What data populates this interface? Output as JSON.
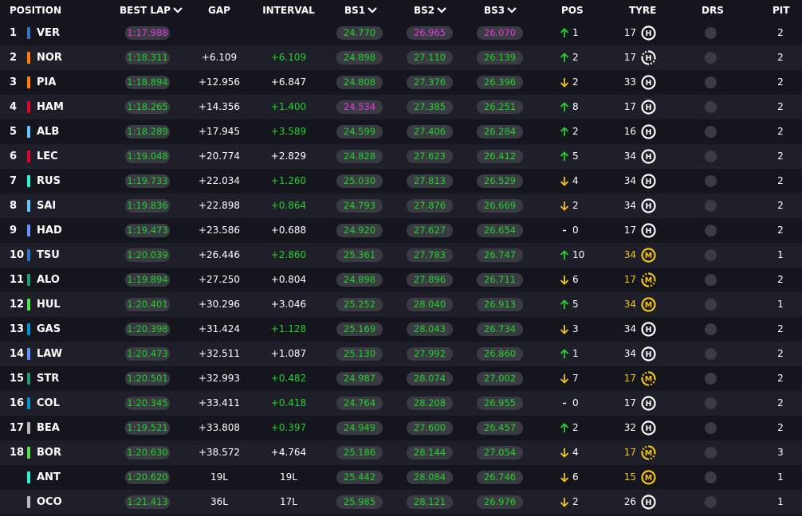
{
  "header": {
    "position": "POSITION",
    "best_lap": "BEST LAP",
    "gap": "GAP",
    "interval": "INTERVAL",
    "bs1": "BS1",
    "bs2": "BS2",
    "bs3": "BS3",
    "pos": "POS",
    "tyre": "TYRE",
    "drs": "DRS",
    "pit": "PIT"
  },
  "colors": {
    "green": "#22d12b",
    "purple": "#e23ae0",
    "yellow": "#f5c518",
    "pill_bg": "#3a3a42",
    "row_dark": "#15151e",
    "row_light": "#1f1f29"
  },
  "rows": [
    {
      "pos": "1",
      "code": "VER",
      "team_color": "#3671c6",
      "best_lap": "1:17.988",
      "best_lap_color": "purple",
      "gap": "",
      "interval": "",
      "interval_color": "white",
      "bs1": "24.770",
      "bs1_color": "green",
      "bs2": "26.965",
      "bs2_color": "purple",
      "bs3": "26.070",
      "bs3_color": "purple",
      "pos_change": "up",
      "pos_change_value": "1",
      "tyre_age": "17",
      "tyre": "H",
      "tyre_new": false,
      "drs": false,
      "pit": "2"
    },
    {
      "pos": "2",
      "code": "NOR",
      "team_color": "#ff8000",
      "best_lap": "1:18.311",
      "best_lap_color": "green",
      "gap": "+6.109",
      "interval": "+6.109",
      "interval_color": "green",
      "bs1": "24.898",
      "bs1_color": "green",
      "bs2": "27.110",
      "bs2_color": "green",
      "bs3": "26.139",
      "bs3_color": "green",
      "pos_change": "up",
      "pos_change_value": "2",
      "tyre_age": "17",
      "tyre": "H",
      "tyre_new": true,
      "drs": false,
      "pit": "2"
    },
    {
      "pos": "3",
      "code": "PIA",
      "team_color": "#ff8000",
      "best_lap": "1:18.894",
      "best_lap_color": "green",
      "gap": "+12.956",
      "interval": "+6.847",
      "interval_color": "white",
      "bs1": "24.808",
      "bs1_color": "green",
      "bs2": "27.376",
      "bs2_color": "green",
      "bs3": "26.396",
      "bs3_color": "green",
      "pos_change": "down",
      "pos_change_value": "2",
      "tyre_age": "33",
      "tyre": "H",
      "tyre_new": false,
      "drs": false,
      "pit": "2"
    },
    {
      "pos": "4",
      "code": "HAM",
      "team_color": "#e8002d",
      "best_lap": "1:18.265",
      "best_lap_color": "green",
      "gap": "+14.356",
      "interval": "+1.400",
      "interval_color": "green",
      "bs1": "24.534",
      "bs1_color": "purple",
      "bs2": "27.385",
      "bs2_color": "green",
      "bs3": "26.251",
      "bs3_color": "green",
      "pos_change": "up",
      "pos_change_value": "8",
      "tyre_age": "17",
      "tyre": "H",
      "tyre_new": false,
      "drs": false,
      "pit": "2"
    },
    {
      "pos": "5",
      "code": "ALB",
      "team_color": "#64c4ff",
      "best_lap": "1:18.289",
      "best_lap_color": "green",
      "gap": "+17.945",
      "interval": "+3.589",
      "interval_color": "green",
      "bs1": "24.599",
      "bs1_color": "green",
      "bs2": "27.406",
      "bs2_color": "green",
      "bs3": "26.284",
      "bs3_color": "green",
      "pos_change": "up",
      "pos_change_value": "2",
      "tyre_age": "16",
      "tyre": "H",
      "tyre_new": false,
      "drs": false,
      "pit": "2"
    },
    {
      "pos": "6",
      "code": "LEC",
      "team_color": "#e8002d",
      "best_lap": "1:19.048",
      "best_lap_color": "green",
      "gap": "+20.774",
      "interval": "+2.829",
      "interval_color": "white",
      "bs1": "24.828",
      "bs1_color": "green",
      "bs2": "27.623",
      "bs2_color": "green",
      "bs3": "26.412",
      "bs3_color": "green",
      "pos_change": "up",
      "pos_change_value": "5",
      "tyre_age": "34",
      "tyre": "H",
      "tyre_new": false,
      "drs": false,
      "pit": "2"
    },
    {
      "pos": "7",
      "code": "RUS",
      "team_color": "#27f4d2",
      "best_lap": "1:19.733",
      "best_lap_color": "green",
      "gap": "+22.034",
      "interval": "+1.260",
      "interval_color": "green",
      "bs1": "25.030",
      "bs1_color": "green",
      "bs2": "27.813",
      "bs2_color": "green",
      "bs3": "26.529",
      "bs3_color": "green",
      "pos_change": "down",
      "pos_change_value": "4",
      "tyre_age": "34",
      "tyre": "H",
      "tyre_new": false,
      "drs": false,
      "pit": "2"
    },
    {
      "pos": "8",
      "code": "SAI",
      "team_color": "#64c4ff",
      "best_lap": "1:19.836",
      "best_lap_color": "green",
      "gap": "+22.898",
      "interval": "+0.864",
      "interval_color": "green",
      "bs1": "24.793",
      "bs1_color": "green",
      "bs2": "27.876",
      "bs2_color": "green",
      "bs3": "26.669",
      "bs3_color": "green",
      "pos_change": "down",
      "pos_change_value": "2",
      "tyre_age": "34",
      "tyre": "H",
      "tyre_new": false,
      "drs": false,
      "pit": "2"
    },
    {
      "pos": "9",
      "code": "HAD",
      "team_color": "#6692ff",
      "best_lap": "1:19.473",
      "best_lap_color": "green",
      "gap": "+23.586",
      "interval": "+0.688",
      "interval_color": "white",
      "bs1": "24.920",
      "bs1_color": "green",
      "bs2": "27.627",
      "bs2_color": "green",
      "bs3": "26.654",
      "bs3_color": "green",
      "pos_change": "same",
      "pos_change_value": "0",
      "tyre_age": "17",
      "tyre": "H",
      "tyre_new": false,
      "drs": false,
      "pit": "2"
    },
    {
      "pos": "10",
      "code": "TSU",
      "team_color": "#3671c6",
      "best_lap": "1:20.039",
      "best_lap_color": "green",
      "gap": "+26.446",
      "interval": "+2.860",
      "interval_color": "green",
      "bs1": "25.361",
      "bs1_color": "green",
      "bs2": "27.783",
      "bs2_color": "green",
      "bs3": "26.747",
      "bs3_color": "green",
      "pos_change": "up",
      "pos_change_value": "10",
      "tyre_age": "34",
      "tyre": "M",
      "tyre_new": false,
      "drs": false,
      "pit": "1"
    },
    {
      "pos": "11",
      "code": "ALO",
      "team_color": "#229971",
      "best_lap": "1:19.894",
      "best_lap_color": "green",
      "gap": "+27.250",
      "interval": "+0.804",
      "interval_color": "white",
      "bs1": "24.898",
      "bs1_color": "green",
      "bs2": "27.896",
      "bs2_color": "green",
      "bs3": "26.711",
      "bs3_color": "green",
      "pos_change": "down",
      "pos_change_value": "6",
      "tyre_age": "17",
      "tyre": "M",
      "tyre_new": true,
      "drs": false,
      "pit": "2"
    },
    {
      "pos": "12",
      "code": "HUL",
      "team_color": "#52e252",
      "best_lap": "1:20.401",
      "best_lap_color": "green",
      "gap": "+30.296",
      "interval": "+3.046",
      "interval_color": "white",
      "bs1": "25.252",
      "bs1_color": "green",
      "bs2": "28.040",
      "bs2_color": "green",
      "bs3": "26.913",
      "bs3_color": "green",
      "pos_change": "up",
      "pos_change_value": "5",
      "tyre_age": "34",
      "tyre": "M",
      "tyre_new": false,
      "drs": false,
      "pit": "1"
    },
    {
      "pos": "13",
      "code": "GAS",
      "team_color": "#0093cc",
      "best_lap": "1:20.398",
      "best_lap_color": "green",
      "gap": "+31.424",
      "interval": "+1.128",
      "interval_color": "green",
      "bs1": "25.169",
      "bs1_color": "green",
      "bs2": "28.043",
      "bs2_color": "green",
      "bs3": "26.734",
      "bs3_color": "green",
      "pos_change": "down",
      "pos_change_value": "3",
      "tyre_age": "34",
      "tyre": "H",
      "tyre_new": false,
      "drs": false,
      "pit": "2"
    },
    {
      "pos": "14",
      "code": "LAW",
      "team_color": "#6692ff",
      "best_lap": "1:20.473",
      "best_lap_color": "green",
      "gap": "+32.511",
      "interval": "+1.087",
      "interval_color": "white",
      "bs1": "25.130",
      "bs1_color": "green",
      "bs2": "27.992",
      "bs2_color": "green",
      "bs3": "26.860",
      "bs3_color": "green",
      "pos_change": "up",
      "pos_change_value": "1",
      "tyre_age": "34",
      "tyre": "H",
      "tyre_new": false,
      "drs": false,
      "pit": "2"
    },
    {
      "pos": "15",
      "code": "STR",
      "team_color": "#229971",
      "best_lap": "1:20.501",
      "best_lap_color": "green",
      "gap": "+32.993",
      "interval": "+0.482",
      "interval_color": "green",
      "bs1": "24.987",
      "bs1_color": "green",
      "bs2": "28.074",
      "bs2_color": "green",
      "bs3": "27.002",
      "bs3_color": "green",
      "pos_change": "down",
      "pos_change_value": "7",
      "tyre_age": "17",
      "tyre": "M",
      "tyre_new": true,
      "drs": false,
      "pit": "2"
    },
    {
      "pos": "16",
      "code": "COL",
      "team_color": "#0093cc",
      "best_lap": "1:20.345",
      "best_lap_color": "green",
      "gap": "+33.411",
      "interval": "+0.418",
      "interval_color": "green",
      "bs1": "24.764",
      "bs1_color": "green",
      "bs2": "28.208",
      "bs2_color": "green",
      "bs3": "26.955",
      "bs3_color": "green",
      "pos_change": "same",
      "pos_change_value": "0",
      "tyre_age": "17",
      "tyre": "H",
      "tyre_new": false,
      "drs": false,
      "pit": "2"
    },
    {
      "pos": "17",
      "code": "BEA",
      "team_color": "#b6babd",
      "best_lap": "1:19.521",
      "best_lap_color": "green",
      "gap": "+33.808",
      "interval": "+0.397",
      "interval_color": "green",
      "bs1": "24.949",
      "bs1_color": "green",
      "bs2": "27.600",
      "bs2_color": "green",
      "bs3": "26.457",
      "bs3_color": "green",
      "pos_change": "up",
      "pos_change_value": "2",
      "tyre_age": "32",
      "tyre": "H",
      "tyre_new": false,
      "drs": false,
      "pit": "2"
    },
    {
      "pos": "18",
      "code": "BOR",
      "team_color": "#52e252",
      "best_lap": "1:20.630",
      "best_lap_color": "green",
      "gap": "+38.572",
      "interval": "+4.764",
      "interval_color": "white",
      "bs1": "25.186",
      "bs1_color": "green",
      "bs2": "28.144",
      "bs2_color": "green",
      "bs3": "27.054",
      "bs3_color": "green",
      "pos_change": "down",
      "pos_change_value": "4",
      "tyre_age": "17",
      "tyre": "M",
      "tyre_new": true,
      "drs": false,
      "pit": "3"
    },
    {
      "pos": "",
      "code": "ANT",
      "team_color": "#27f4d2",
      "best_lap": "1:20.620",
      "best_lap_color": "green",
      "gap": "19L",
      "interval": "19L",
      "interval_color": "white",
      "bs1": "25.442",
      "bs1_color": "green",
      "bs2": "28.084",
      "bs2_color": "green",
      "bs3": "26.746",
      "bs3_color": "green",
      "pos_change": "down",
      "pos_change_value": "6",
      "tyre_age": "15",
      "tyre": "M",
      "tyre_new": false,
      "drs": false,
      "pit": "1"
    },
    {
      "pos": "",
      "code": "OCO",
      "team_color": "#b6babd",
      "best_lap": "1:21.413",
      "best_lap_color": "green",
      "gap": "36L",
      "interval": "17L",
      "interval_color": "white",
      "bs1": "25.985",
      "bs1_color": "green",
      "bs2": "28.121",
      "bs2_color": "green",
      "bs3": "26.976",
      "bs3_color": "green",
      "pos_change": "down",
      "pos_change_value": "2",
      "tyre_age": "26",
      "tyre": "H",
      "tyre_new": false,
      "drs": false,
      "pit": "1"
    }
  ]
}
